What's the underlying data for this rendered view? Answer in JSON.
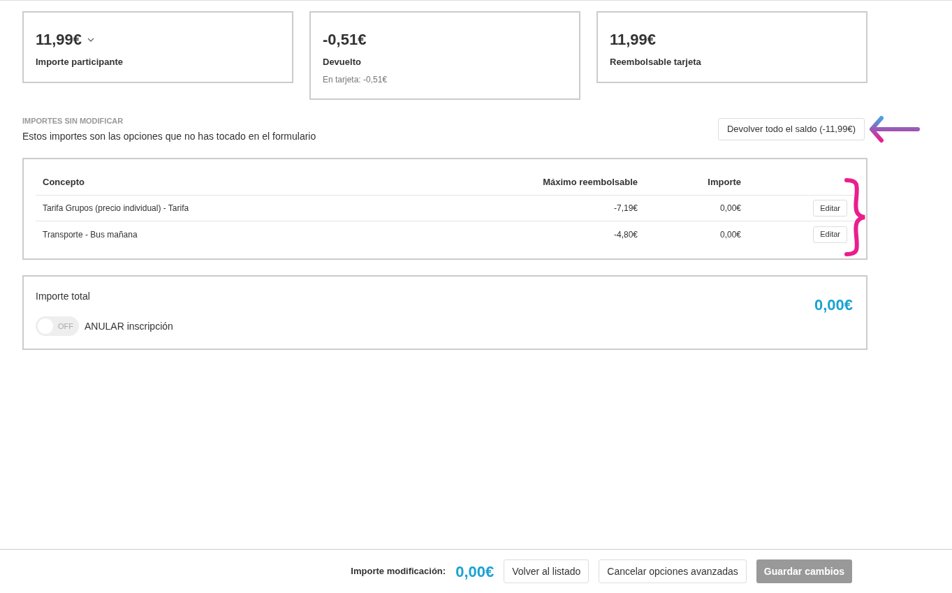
{
  "summary_cards": [
    {
      "amount": "11,99€",
      "has_dropdown": true,
      "label": "Importe participante"
    },
    {
      "amount": "-0,51€",
      "label": "Devuelto",
      "note": "En tarjeta: -0,51€"
    },
    {
      "amount": "11,99€",
      "label": "Reembolsable tarjeta"
    }
  ],
  "unmodified": {
    "heading": "IMPORTES SIN MODIFICAR",
    "description": "Estos importes son las opciones que no has tocado en el formulario",
    "refund_button": "Devolver todo el saldo (-11,99€)"
  },
  "table": {
    "columns": [
      "Concepto",
      "Máximo reembolsable",
      "Importe"
    ],
    "rows": [
      {
        "concept": "Tarifa Grupos (precio individual) - Tarifa",
        "max": "-7,19€",
        "amount": "0,00€",
        "action": "Editar"
      },
      {
        "concept": "Transporte - Bus mañana",
        "max": "-4,80€",
        "amount": "0,00€",
        "action": "Editar"
      }
    ]
  },
  "total": {
    "label": "Importe total",
    "amount": "0,00€",
    "toggle": {
      "on": false,
      "state_label": "OFF",
      "label": "ANULAR inscripción"
    }
  },
  "footer": {
    "label": "Importe modificación:",
    "amount": "0,00€",
    "buttons": [
      {
        "label": "Volver al listado",
        "disabled": false
      },
      {
        "label": "Cancelar opciones avanzadas",
        "disabled": false
      },
      {
        "label": "Guardar cambios",
        "disabled": true
      }
    ]
  }
}
